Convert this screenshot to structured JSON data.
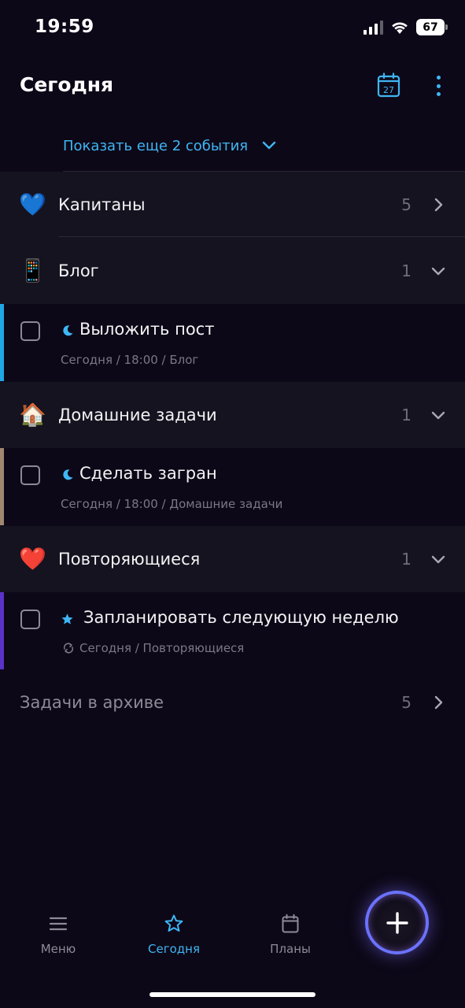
{
  "status_bar": {
    "time": "19:59",
    "battery": "67"
  },
  "header": {
    "title": "Сегодня",
    "calendar_day": "27"
  },
  "show_more": {
    "label": "Показать еще 2 события"
  },
  "groups": [
    {
      "emoji": "💙",
      "title": "Капитаны",
      "count": "5",
      "expanded": false
    },
    {
      "emoji": "📱",
      "title": "Блог",
      "count": "1",
      "expanded": true
    },
    {
      "emoji": "🏠",
      "title": "Домашние задачи",
      "count": "1",
      "expanded": true
    },
    {
      "emoji": "❤️",
      "title": "Повторяющиеся",
      "count": "1",
      "expanded": true
    }
  ],
  "tasks": [
    {
      "title": "Выложить пост",
      "meta": "Сегодня / 18:00 / Блог",
      "icon": "moon-icon",
      "accent": "#1ea7e4"
    },
    {
      "title": "Сделать загран",
      "meta": "Сегодня / 18:00 / Домашние задачи",
      "icon": "moon-icon",
      "accent": "#a08870"
    },
    {
      "title": "Запланировать следующую неделю",
      "meta": "Сегодня / Повторяющиеся",
      "icon": "star-icon",
      "meta_icon": "repeat-icon",
      "accent": "#5a32c8"
    }
  ],
  "archive": {
    "label": "Задачи в архиве",
    "count": "5"
  },
  "nav": [
    {
      "label": "Меню",
      "icon": "menu-icon",
      "active": false
    },
    {
      "label": "Сегодня",
      "icon": "star-icon",
      "active": true
    },
    {
      "label": "Планы",
      "icon": "calendar-icon",
      "active": false
    }
  ],
  "colors": {
    "accent": "#3fb6f5",
    "background": "#0d0817",
    "group_bg": "#15131f"
  }
}
